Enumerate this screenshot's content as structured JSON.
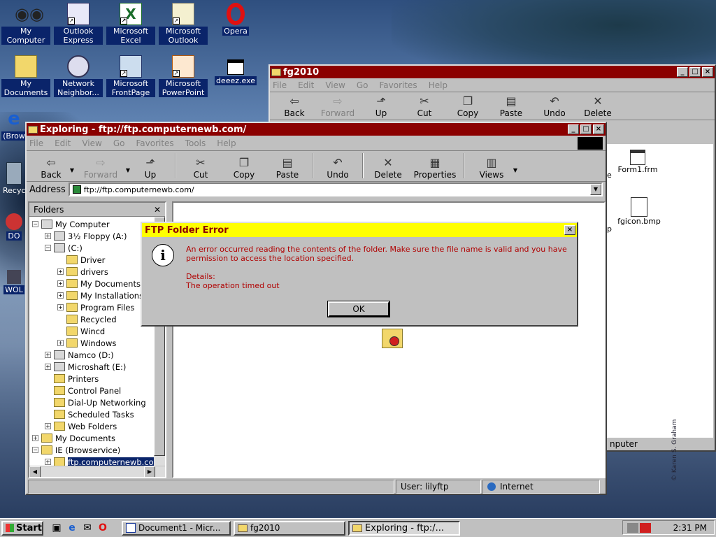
{
  "desktop": {
    "icons": [
      {
        "label": "My Computer"
      },
      {
        "label": "Outlook Express"
      },
      {
        "label": "Microsoft Excel"
      },
      {
        "label": "Microsoft Outlook"
      },
      {
        "label": "Opera"
      },
      {
        "label": "My Documents"
      },
      {
        "label": "Network Neighbor..."
      },
      {
        "label": "Microsoft FrontPage"
      },
      {
        "label": "Microsoft PowerPoint"
      },
      {
        "label": "deeez.exe"
      }
    ],
    "partial_labels": [
      "(Brow",
      "Recyc",
      "DO",
      "WOL"
    ],
    "watermark": "© Karen S. Graham"
  },
  "back_window": {
    "title": "fg2010",
    "menu": [
      "File",
      "Edit",
      "View",
      "Go",
      "Favorites",
      "Help"
    ],
    "toolbar": [
      "Back",
      "Forward",
      "Up",
      "Cut",
      "Copy",
      "Paste",
      "Undo",
      "Delete"
    ],
    "files": [
      {
        "name": "Form1.frm"
      },
      {
        "name": "fgicon.bmp"
      }
    ],
    "partial_texts": [
      "e",
      "p"
    ],
    "status_partial": "nputer"
  },
  "main_window": {
    "title": "Exploring - ftp://ftp.computernewb.com/",
    "menu": [
      "File",
      "Edit",
      "View",
      "Go",
      "Favorites",
      "Tools",
      "Help"
    ],
    "toolbar": {
      "back": "Back",
      "forward": "Forward",
      "up": "Up",
      "cut": "Cut",
      "copy": "Copy",
      "paste": "Paste",
      "undo": "Undo",
      "delete": "Delete",
      "properties": "Properties",
      "views": "Views"
    },
    "address_label": "Address",
    "address_value": "ftp://ftp.computernewb.com/",
    "folders_title": "Folders",
    "tree": [
      {
        "label": "My Computer",
        "level": 0,
        "pm": "-"
      },
      {
        "label": "3½ Floppy (A:)",
        "level": 1,
        "pm": "+"
      },
      {
        "label": "(C:)",
        "level": 1,
        "pm": "-"
      },
      {
        "label": "Driver",
        "level": 2,
        "pm": ""
      },
      {
        "label": "drivers",
        "level": 2,
        "pm": "+"
      },
      {
        "label": "My Documents",
        "level": 2,
        "pm": "+"
      },
      {
        "label": "My Installations",
        "level": 2,
        "pm": "+"
      },
      {
        "label": "Program Files",
        "level": 2,
        "pm": "+"
      },
      {
        "label": "Recycled",
        "level": 2,
        "pm": ""
      },
      {
        "label": "Wincd",
        "level": 2,
        "pm": ""
      },
      {
        "label": "Windows",
        "level": 2,
        "pm": "+"
      },
      {
        "label": "Namco (D:)",
        "level": 1,
        "pm": "+"
      },
      {
        "label": "Microshaft (E:)",
        "level": 1,
        "pm": "+"
      },
      {
        "label": "Printers",
        "level": 1,
        "pm": ""
      },
      {
        "label": "Control Panel",
        "level": 1,
        "pm": ""
      },
      {
        "label": "Dial-Up Networking",
        "level": 1,
        "pm": ""
      },
      {
        "label": "Scheduled Tasks",
        "level": 1,
        "pm": ""
      },
      {
        "label": "Web Folders",
        "level": 1,
        "pm": "+"
      },
      {
        "label": "My Documents",
        "level": 0,
        "pm": "+"
      },
      {
        "label": "IE (Browservice)",
        "level": 0,
        "pm": "-"
      },
      {
        "label": "ftp.computernewb.com",
        "level": 1,
        "pm": "+",
        "selected": true
      }
    ],
    "status": {
      "user": "User: lilyftp",
      "zone": "Internet"
    }
  },
  "dialog": {
    "title": "FTP Folder Error",
    "message": "An error occurred reading the contents of the folder.  Make sure the file name is valid and you have permission to access the location specified.",
    "details_label": "Details:",
    "details_text": "The operation timed out",
    "ok": "OK"
  },
  "taskbar": {
    "start": "Start",
    "tasks": [
      {
        "label": "Document1 - Micr..."
      },
      {
        "label": "fg2010"
      },
      {
        "label": "Exploring - ftp:/..."
      }
    ],
    "clock": "2:31 PM"
  },
  "colors": {
    "title_active": "#8b0000",
    "dialog_title_bg": "#ffff00",
    "dialog_text": "#b00000",
    "selection": "#0a246a"
  }
}
